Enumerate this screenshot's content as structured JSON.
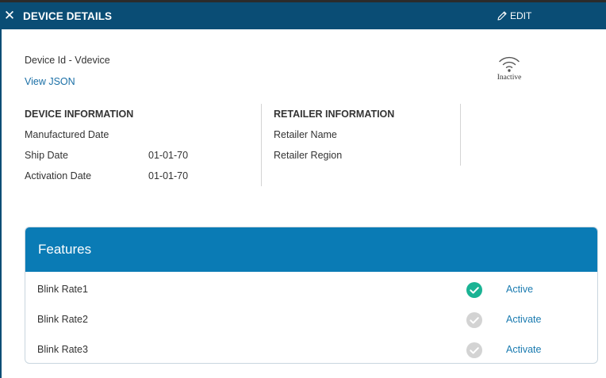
{
  "header": {
    "title": "DEVICE DETAILS",
    "close_icon": "close-icon",
    "edit_label": "EDIT",
    "edit_icon": "pencil-icon",
    "bg_color": "#0a4d75"
  },
  "device": {
    "id_text": "Device Id - Vdevice",
    "view_json_label": "View JSON",
    "status_icon": "wifi-signal-icon",
    "status_label": "Inactive"
  },
  "device_info": {
    "title": "DEVICE INFORMATION",
    "fields": [
      {
        "label": "Manufactured Date",
        "value": ""
      },
      {
        "label": "Ship Date",
        "value": "01-01-70"
      },
      {
        "label": "Activation Date",
        "value": "01-01-70"
      }
    ]
  },
  "retailer_info": {
    "title": "RETAILER INFORMATION",
    "fields": [
      {
        "label": "Retailer Name",
        "value": ""
      },
      {
        "label": "Retailer Region",
        "value": ""
      }
    ]
  },
  "features": {
    "title": "Features",
    "header_color": "#0a7bb5",
    "items": [
      {
        "name": "Blink Rate1",
        "checked": true,
        "action": "Active"
      },
      {
        "name": "Blink Rate2",
        "checked": false,
        "action": "Activate"
      },
      {
        "name": "Blink Rate3",
        "checked": false,
        "action": "Activate"
      }
    ],
    "active_color": "#1ab394",
    "inactive_color": "#d3d3d3"
  }
}
